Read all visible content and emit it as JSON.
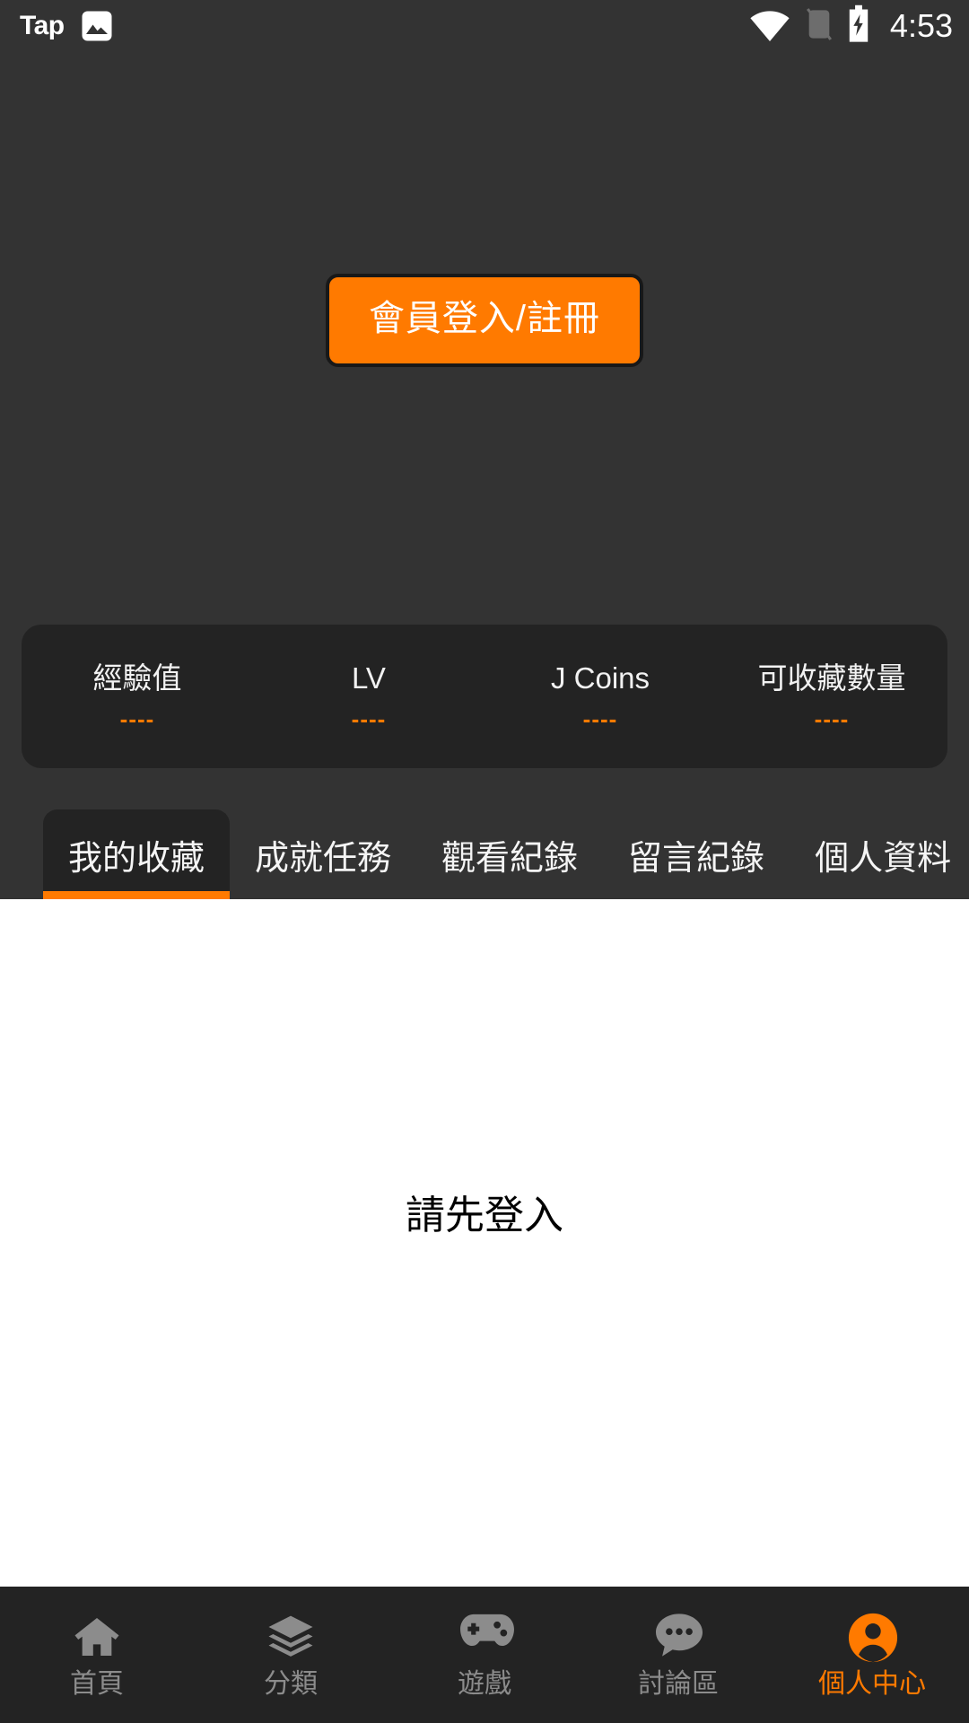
{
  "statusbar": {
    "app_label": "Tap",
    "image_icon": "image-icon",
    "wifi_icon": "wifi-icon",
    "sim_icon": "no-sim-icon",
    "battery_icon": "battery-charging-icon",
    "clock": "4:53"
  },
  "hero": {
    "login_button_label": "會員登入/註冊"
  },
  "stats": [
    {
      "label": "經驗值",
      "value": "----"
    },
    {
      "label": "LV",
      "value": "----"
    },
    {
      "label": "J Coins",
      "value": "----"
    },
    {
      "label": "可收藏數量",
      "value": "----"
    }
  ],
  "tabs": [
    {
      "label": "我的收藏",
      "active": true
    },
    {
      "label": "成就任務",
      "active": false
    },
    {
      "label": "觀看紀錄",
      "active": false
    },
    {
      "label": "留言紀錄",
      "active": false
    },
    {
      "label": "個人資料",
      "active": false
    }
  ],
  "content": {
    "empty_message": "請先登入"
  },
  "bottomnav": [
    {
      "label": "首頁",
      "icon": "home-icon",
      "active": false
    },
    {
      "label": "分類",
      "icon": "layers-icon",
      "active": false
    },
    {
      "label": "遊戲",
      "icon": "gamepad-icon",
      "active": false
    },
    {
      "label": "討論區",
      "icon": "chat-bubble-icon",
      "active": false
    },
    {
      "label": "個人中心",
      "icon": "person-icon",
      "active": true
    }
  ],
  "colors": {
    "accent": "#FF7A00",
    "background": "#333333",
    "panel": "#232323",
    "content_bg": "#FFFFFF",
    "inactive_nav": "#8C8C8C"
  }
}
